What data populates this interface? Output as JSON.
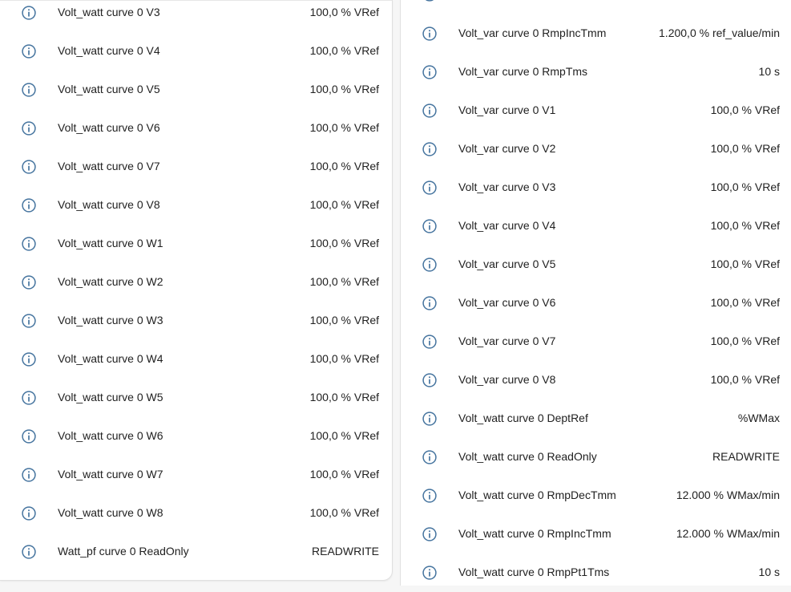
{
  "left_panel": {
    "rows": [
      {
        "label": "Volt_watt curve 0 V3",
        "value": "100,0 % VRef"
      },
      {
        "label": "Volt_watt curve 0 V4",
        "value": "100,0 % VRef"
      },
      {
        "label": "Volt_watt curve 0 V5",
        "value": "100,0 % VRef"
      },
      {
        "label": "Volt_watt curve 0 V6",
        "value": "100,0 % VRef"
      },
      {
        "label": "Volt_watt curve 0 V7",
        "value": "100,0 % VRef"
      },
      {
        "label": "Volt_watt curve 0 V8",
        "value": "100,0 % VRef"
      },
      {
        "label": "Volt_watt curve 0 W1",
        "value": "100,0 % VRef"
      },
      {
        "label": "Volt_watt curve 0 W2",
        "value": "100,0 % VRef"
      },
      {
        "label": "Volt_watt curve 0 W3",
        "value": "100,0 % VRef"
      },
      {
        "label": "Volt_watt curve 0 W4",
        "value": "100,0 % VRef"
      },
      {
        "label": "Volt_watt curve 0 W5",
        "value": "100,0 % VRef"
      },
      {
        "label": "Volt_watt curve 0 W6",
        "value": "100,0 % VRef"
      },
      {
        "label": "Volt_watt curve 0 W7",
        "value": "100,0 % VRef"
      },
      {
        "label": "Volt_watt curve 0 W8",
        "value": "100,0 % VRef"
      },
      {
        "label": "Watt_pf curve 0 ReadOnly",
        "value": "READWRITE"
      }
    ]
  },
  "right_panel": {
    "rows": [
      {
        "label": "Volt_var curve 0 RmpIncTmm",
        "value": "1.200,0 % ref_value/min"
      },
      {
        "label": "Volt_var curve 0 RmpTms",
        "value": "10 s"
      },
      {
        "label": "Volt_var curve 0 V1",
        "value": "100,0 % VRef"
      },
      {
        "label": "Volt_var curve 0 V2",
        "value": "100,0 % VRef"
      },
      {
        "label": "Volt_var curve 0 V3",
        "value": "100,0 % VRef"
      },
      {
        "label": "Volt_var curve 0 V4",
        "value": "100,0 % VRef"
      },
      {
        "label": "Volt_var curve 0 V5",
        "value": "100,0 % VRef"
      },
      {
        "label": "Volt_var curve 0 V6",
        "value": "100,0 % VRef"
      },
      {
        "label": "Volt_var curve 0 V7",
        "value": "100,0 % VRef"
      },
      {
        "label": "Volt_var curve 0 V8",
        "value": "100,0 % VRef"
      },
      {
        "label": "Volt_watt curve 0 DeptRef",
        "value": "%WMax"
      },
      {
        "label": "Volt_watt curve 0 ReadOnly",
        "value": "READWRITE"
      },
      {
        "label": "Volt_watt curve 0 RmpDecTmm",
        "value": "12.000 % WMax/min"
      },
      {
        "label": "Volt_watt curve 0 RmpIncTmm",
        "value": "12.000 % WMax/min"
      },
      {
        "label": "Volt_watt curve 0 RmpPt1Tms",
        "value": "10 s"
      }
    ]
  },
  "icon_name": "info-icon",
  "colors": {
    "icon": "#44739e",
    "text": "#212121",
    "card": "#ffffff",
    "background": "#f6f6f6"
  }
}
